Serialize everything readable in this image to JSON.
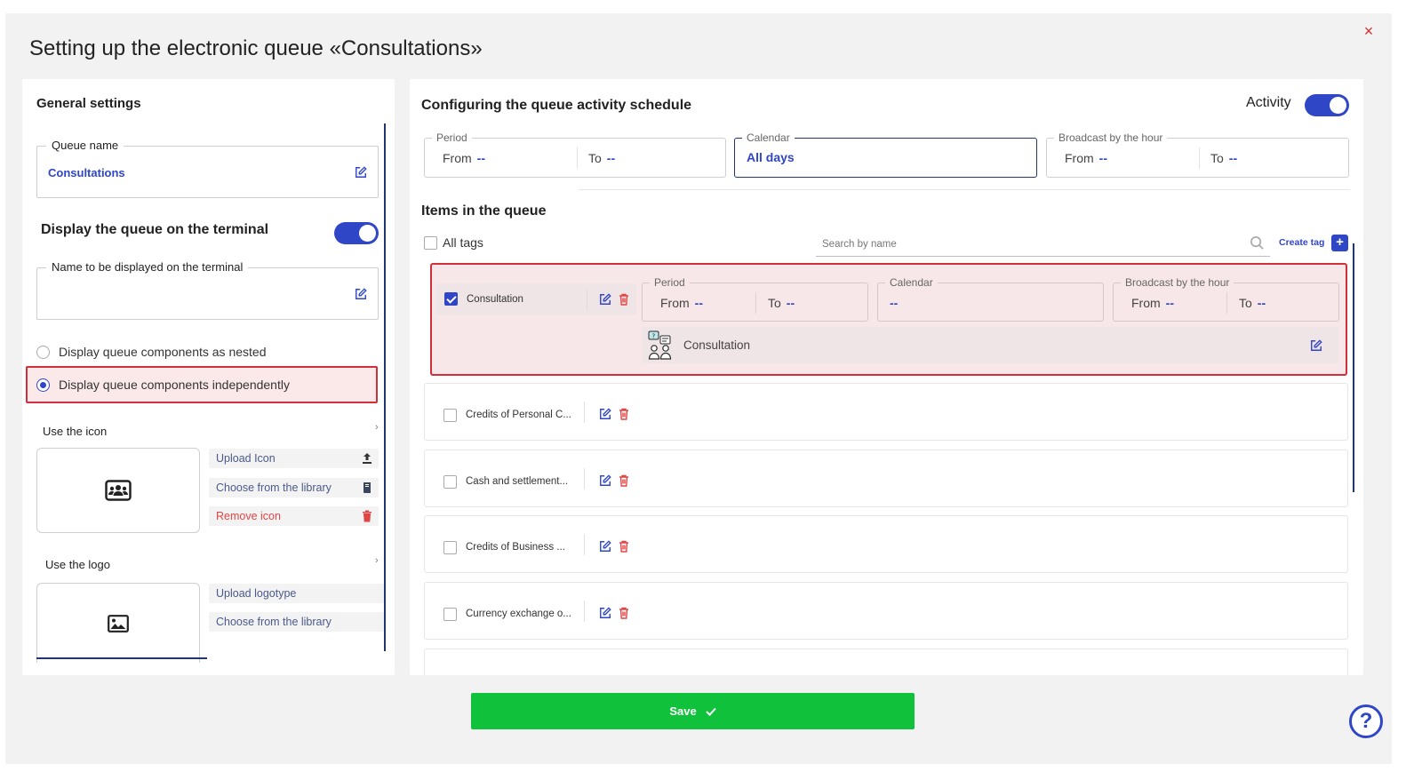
{
  "modal": {
    "title": "Setting up the electronic queue «Consultations»",
    "close_label": "×"
  },
  "general": {
    "title": "General settings",
    "queue_name_label": "Queue name",
    "queue_name_value": "Consultations",
    "terminal_title": "Display the queue on the terminal",
    "terminal_toggle_on": true,
    "terminal_name_label": "Name to be displayed on the terminal",
    "terminal_name_value": "",
    "radio_nested": "Display queue components as nested",
    "radio_independent": "Display queue components independently",
    "selected_radio": "independent",
    "use_icon_label": "Use the icon",
    "upload_icon": "Upload Icon",
    "choose_library": "Choose from the library",
    "remove_icon": "Remove icon",
    "use_logo_label": "Use the logo",
    "upload_logotype": "Upload logotype",
    "choose_library_logo": "Choose from the library",
    "chevron": "›"
  },
  "schedule": {
    "title": "Configuring the queue activity schedule",
    "activity_label": "Activity",
    "activity_on": true,
    "period_legend": "Period",
    "from_label": "From",
    "to_label": "To",
    "empty_value": "--",
    "calendar_legend": "Calendar",
    "calendar_value": "All days",
    "broadcast_legend": "Broadcast by the hour"
  },
  "items": {
    "title": "Items in the queue",
    "all_tags_label": "All tags",
    "search_placeholder": "Search by name",
    "create_tag_label": "Create tag",
    "plus_label": "+",
    "selected": {
      "name": "Consultation",
      "period_legend": "Period",
      "calendar_legend": "Calendar",
      "calendar_value": "--",
      "broadcast_legend": "Broadcast by the hour",
      "from_label": "From",
      "to_label": "To",
      "empty_value": "--",
      "component_name": "Consultation"
    },
    "list": [
      {
        "name": "Credits of Personal C..."
      },
      {
        "name": "Cash and settlement..."
      },
      {
        "name": "Credits of Business ..."
      },
      {
        "name": "Currency exchange o..."
      }
    ]
  },
  "footer": {
    "save_label": "Save",
    "help_label": "?"
  },
  "colors": {
    "accent": "#2f46c7",
    "danger": "#d32f3a",
    "save": "#10c23b"
  }
}
